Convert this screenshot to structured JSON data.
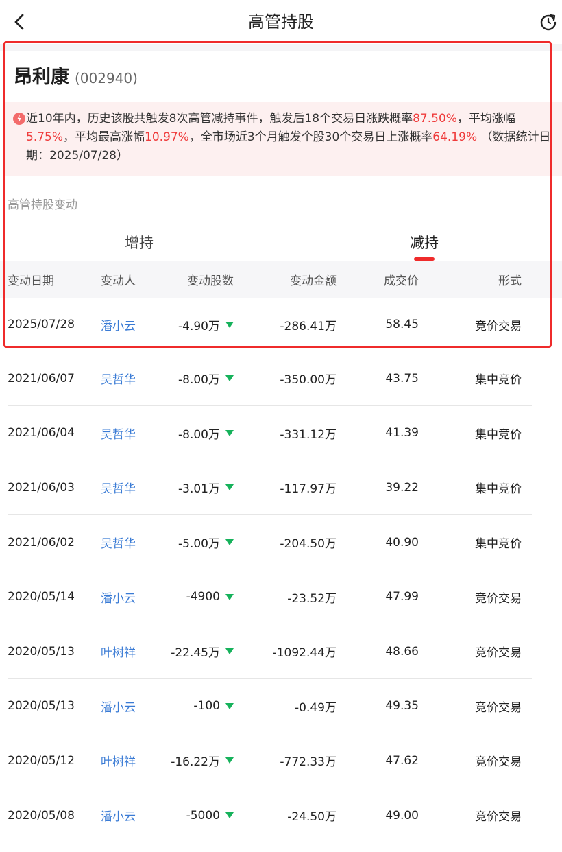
{
  "header": {
    "title": "高管持股"
  },
  "stock": {
    "name": "昂利康",
    "code": "(002940)"
  },
  "notice": {
    "p1": "近10年内，历史该股共触发8次高管减持事件，触发后18个交易日涨跌概率",
    "v1": "87.50%",
    "p2": "，平均涨幅",
    "v2": "5.75%",
    "p3": "，平均最高涨幅",
    "v3": "10.97%",
    "p4": "，全市场近3个月触发个股30个交易日上涨概率",
    "v4": "64.19%",
    "p5": " （数据统计日期：2025/07/28）"
  },
  "section": {
    "label": "高管持股变动"
  },
  "tabs": [
    {
      "label": "增持",
      "active": false
    },
    {
      "label": "减持",
      "active": true
    }
  ],
  "table": {
    "columns": [
      "变动日期",
      "变动人",
      "变动股数",
      "变动金额",
      "成交价",
      "形式"
    ],
    "rows": [
      {
        "date": "2025/07/28",
        "person": "潘小云",
        "shares": "-4.90万",
        "amount": "-286.41万",
        "price": "58.45",
        "form": "竞价交易"
      },
      {
        "date": "2021/06/07",
        "person": "吴哲华",
        "shares": "-8.00万",
        "amount": "-350.00万",
        "price": "43.75",
        "form": "集中竞价"
      },
      {
        "date": "2021/06/04",
        "person": "吴哲华",
        "shares": "-8.00万",
        "amount": "-331.12万",
        "price": "41.39",
        "form": "集中竞价"
      },
      {
        "date": "2021/06/03",
        "person": "吴哲华",
        "shares": "-3.01万",
        "amount": "-117.97万",
        "price": "39.22",
        "form": "集中竞价"
      },
      {
        "date": "2021/06/02",
        "person": "吴哲华",
        "shares": "-5.00万",
        "amount": "-204.50万",
        "price": "40.90",
        "form": "集中竞价"
      },
      {
        "date": "2020/05/14",
        "person": "潘小云",
        "shares": "-4900",
        "amount": "-23.52万",
        "price": "47.99",
        "form": "竞价交易"
      },
      {
        "date": "2020/05/13",
        "person": "叶树祥",
        "shares": "-22.45万",
        "amount": "-1092.44万",
        "price": "48.66",
        "form": "竞价交易"
      },
      {
        "date": "2020/05/13",
        "person": "潘小云",
        "shares": "-100",
        "amount": "-0.49万",
        "price": "49.35",
        "form": "竞价交易"
      },
      {
        "date": "2020/05/12",
        "person": "叶树祥",
        "shares": "-16.22万",
        "amount": "-772.33万",
        "price": "47.62",
        "form": "竞价交易"
      },
      {
        "date": "2020/05/08",
        "person": "潘小云",
        "shares": "-5000",
        "amount": "-24.50万",
        "price": "49.00",
        "form": "竞价交易"
      }
    ]
  },
  "colors": {
    "accent": "#ef2b2b",
    "link": "#3a7bd5",
    "down": "#16b25b",
    "notice_bg": "#fdf0f0"
  },
  "icons": {
    "back": "chevron-left-icon",
    "refresh": "refresh-icon",
    "notice": "alert-badge-icon",
    "trend": "down-triangle-icon"
  }
}
